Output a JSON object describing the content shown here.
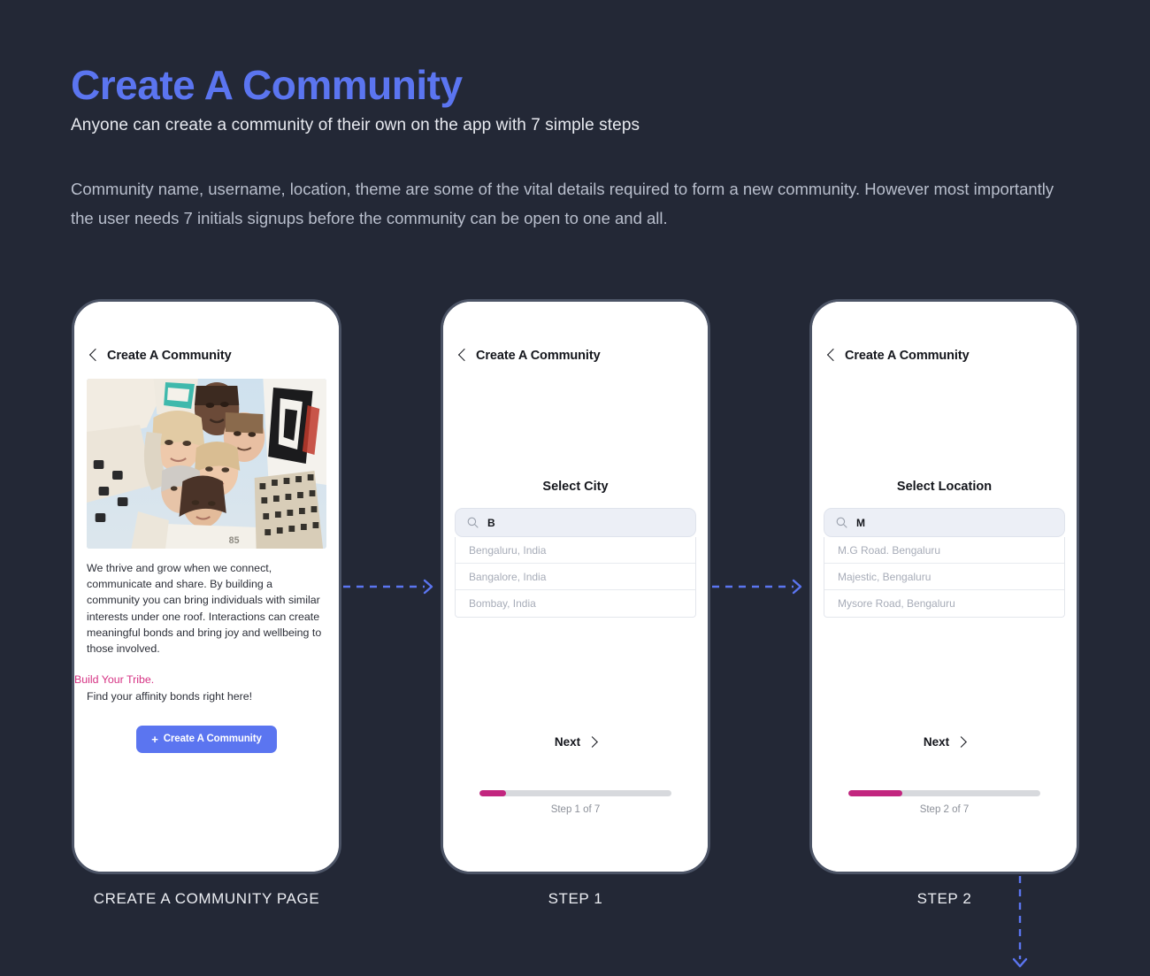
{
  "header": {
    "title": "Create A Community",
    "subtitle": "Anyone can create a community of their own on the app with 7 simple steps",
    "description": "Community name, username, location, theme are some of the vital details required to form a new community. However most importantly the user needs 7 initials signups before the community can be open to one and all.",
    "title_color": "#5b75f0"
  },
  "colors": {
    "background": "#232836",
    "accent_blue": "#5b75f0",
    "accent_pink": "#c2267f",
    "tribe_pink": "#d63384",
    "phone_frame": "#4c5466"
  },
  "phones": {
    "phone1": {
      "caption": "CREATE A COMMUNITY PAGE",
      "app_bar": {
        "title": "Create A Community",
        "back_icon": "chevron-left-icon"
      },
      "photo_alt": "group-of-young-people-circle-photo",
      "body_paragraph": "We thrive and grow when we connect, communicate and share. By building a community you can bring individuals with similar interests under one roof. Interactions can create meaningful bonds and bring joy and wellbeing to those involved.",
      "tribe_headline": "Build Your Tribe.",
      "tribe_subline": "Find your affinity bonds right here!",
      "cta_plus": "+",
      "cta_label": "Create A Community"
    },
    "phone2": {
      "caption": "STEP 1",
      "app_bar": {
        "title": "Create A Community",
        "back_icon": "chevron-left-icon"
      },
      "step_heading": "Select City",
      "search": {
        "icon": "search-icon",
        "value": "B",
        "placeholder": "B"
      },
      "suggestions": [
        "Bengaluru, India",
        "Bangalore, India",
        "Bombay, India"
      ],
      "next_label": "Next",
      "next_icon": "chevron-right-icon",
      "progress_label": "Step 1 of 7",
      "progress_percent": 14
    },
    "phone3": {
      "caption": "STEP 2",
      "app_bar": {
        "title": "Create A Community",
        "back_icon": "chevron-left-icon"
      },
      "step_heading": "Select Location",
      "search": {
        "icon": "search-icon",
        "value": "M",
        "placeholder": "M"
      },
      "suggestions": [
        "M.G Road. Bengaluru",
        "Majestic, Bengaluru",
        "Mysore Road, Bengaluru"
      ],
      "next_label": "Next",
      "next_icon": "chevron-right-icon",
      "progress_label": "Step 2 of 7",
      "progress_percent": 28
    }
  },
  "connectors": [
    {
      "name": "arrow-phone1-to-phone2",
      "direction": "right"
    },
    {
      "name": "arrow-phone2-to-phone3",
      "direction": "right"
    },
    {
      "name": "arrow-phone3-to-next-row",
      "direction": "down"
    }
  ]
}
